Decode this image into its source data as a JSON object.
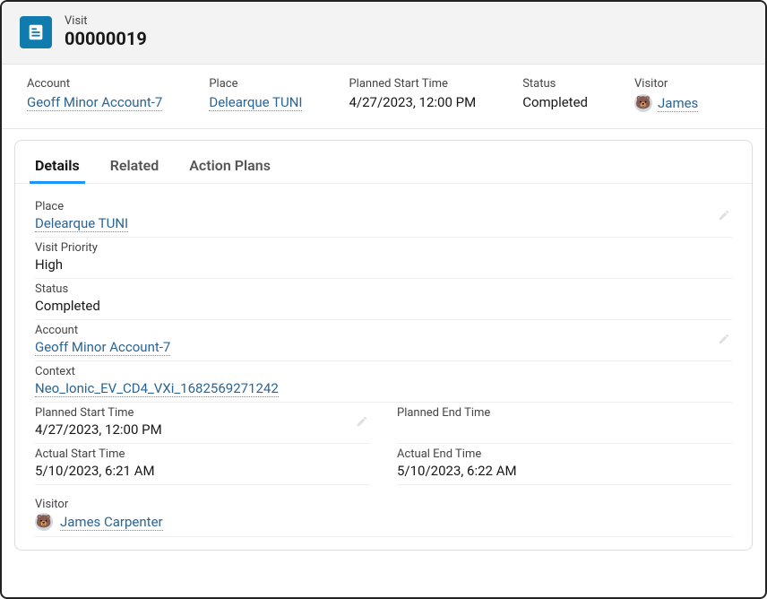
{
  "header": {
    "type_label": "Visit",
    "record_number": "00000019"
  },
  "highlights": {
    "account_label": "Account",
    "account_value": "Geoff Minor Account-7",
    "place_label": "Place",
    "place_value": "Delearque TUNI",
    "planned_start_label": "Planned Start Time",
    "planned_start_value": "4/27/2023, 12:00 PM",
    "status_label": "Status",
    "status_value": "Completed",
    "visitor_label": "Visitor",
    "visitor_value": "James"
  },
  "tabs": {
    "details": "Details",
    "related": "Related",
    "action_plans": "Action Plans"
  },
  "details": {
    "place_label": "Place",
    "place_value": "Delearque TUNI",
    "priority_label": "Visit Priority",
    "priority_value": "High",
    "status_label": "Status",
    "status_value": "Completed",
    "account_label": "Account",
    "account_value": "Geoff Minor Account-7",
    "context_label": "Context",
    "context_value": "Neo_Ionic_EV_CD4_VXi_1682569271242",
    "planned_start_label": "Planned Start Time",
    "planned_start_value": "4/27/2023, 12:00 PM",
    "planned_end_label": "Planned End Time",
    "planned_end_value": "",
    "actual_start_label": "Actual Start Time",
    "actual_start_value": "5/10/2023, 6:21 AM",
    "actual_end_label": "Actual End Time",
    "actual_end_value": "5/10/2023, 6:22 AM",
    "visitor_label": "Visitor",
    "visitor_value": "James Carpenter"
  }
}
